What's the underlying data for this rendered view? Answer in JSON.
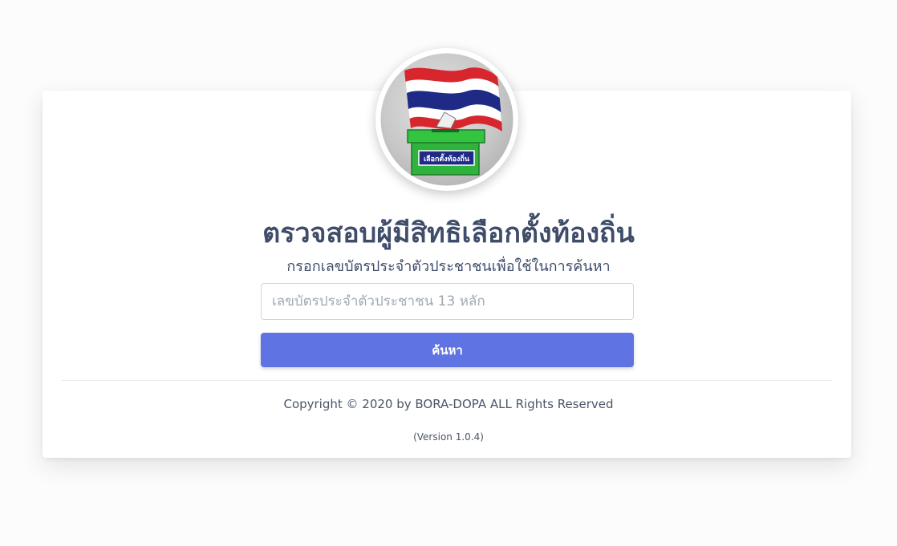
{
  "header": {
    "logo_label": "เลือกตั้งท้องถิ่น",
    "title": "ตรวจสอบผู้มีสิทธิเลือกตั้งท้องถิ่น",
    "subtitle": "กรอกเลขบัตรประจำตัวประชาชนเพื่อใช้ในการค้นหา"
  },
  "form": {
    "id_value": "",
    "id_placeholder": "เลขบัตรประจำตัวประชาชน 13 หลัก",
    "search_label": "ค้นหา"
  },
  "footer": {
    "copyright": "Copyright © 2020 by BORA-DOPA ALL Rights Reserved",
    "version": "(Version 1.0.4)"
  },
  "colors": {
    "button": "#5f73e3",
    "title": "#3f4d6b",
    "flag_red": "#d7262e",
    "flag_blue": "#1f2a86",
    "ballot_green": "#2fb33c"
  },
  "icons": {
    "logo": "thai-flag-ballot-box-icon"
  }
}
